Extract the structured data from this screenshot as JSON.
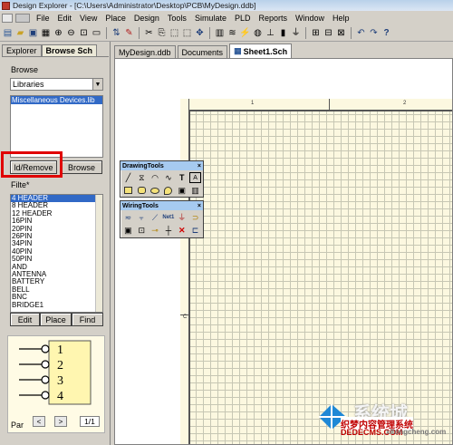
{
  "window": {
    "title": "Design Explorer - [C:\\Users\\Administrator\\Desktop\\PCB\\MyDesign.ddb]"
  },
  "menu": [
    "File",
    "Edit",
    "View",
    "Place",
    "Design",
    "Tools",
    "Simulate",
    "PLD",
    "Reports",
    "Window",
    "Help"
  ],
  "left_panel": {
    "tab_explorer": "Explorer",
    "tab_browse": "Browse Sch",
    "browse_label": "Browse",
    "browse_select": "Libraries",
    "library_selected": "Miscellaneous Devices.lib",
    "add_remove_label": "ld/Remove",
    "browse_button": "Browse",
    "filter_label": "Filte",
    "filter_value": "*",
    "components": [
      "4 HEADER",
      "8 HEADER",
      "12 HEADER",
      "16PIN",
      "20PIN",
      "26PIN",
      "34PIN",
      "40PIN",
      "50PIN",
      "AND",
      "ANTENNA",
      "BATTERY",
      "BELL",
      "BNC",
      "BRIDGE1"
    ],
    "edit_button": "Edit",
    "place_button": "Place",
    "find_button": "Find",
    "preview_pins": [
      "1",
      "2",
      "3",
      "4"
    ],
    "part_label": "Par",
    "page_value": "1/1"
  },
  "doc_tabs": [
    "MyDesign.ddb",
    "Documents",
    "Sheet1.Sch"
  ],
  "sheet": {
    "zone_top": [
      "1",
      "2"
    ],
    "zone_left": [
      "C"
    ]
  },
  "drawing_tools": {
    "title": "DrawingTools",
    "icons": [
      "line-icon",
      "polygon-icon",
      "arc-icon",
      "bezier-icon",
      "text-icon",
      "text-frame-icon",
      "rectangle-icon",
      "rounded-rect-icon",
      "ellipse-icon",
      "pie-icon",
      "graphic-icon",
      "array-icon"
    ]
  },
  "wiring_tools": {
    "title": "WiringTools",
    "icons": [
      "wire-icon",
      "bus-icon",
      "bus-entry-icon",
      "net-label-icon",
      "ground-icon",
      "port-icon",
      "sheet-symbol-icon",
      "sheet-entry-icon",
      "power-port-icon",
      "junction-icon",
      "no-erc-icon",
      "component-icon"
    ]
  },
  "watermark": {
    "line1": "系统城",
    "line2": "织梦内容管理系统",
    "line3": "DEDECMS.COM",
    "line4": "xitongcheng.com"
  }
}
